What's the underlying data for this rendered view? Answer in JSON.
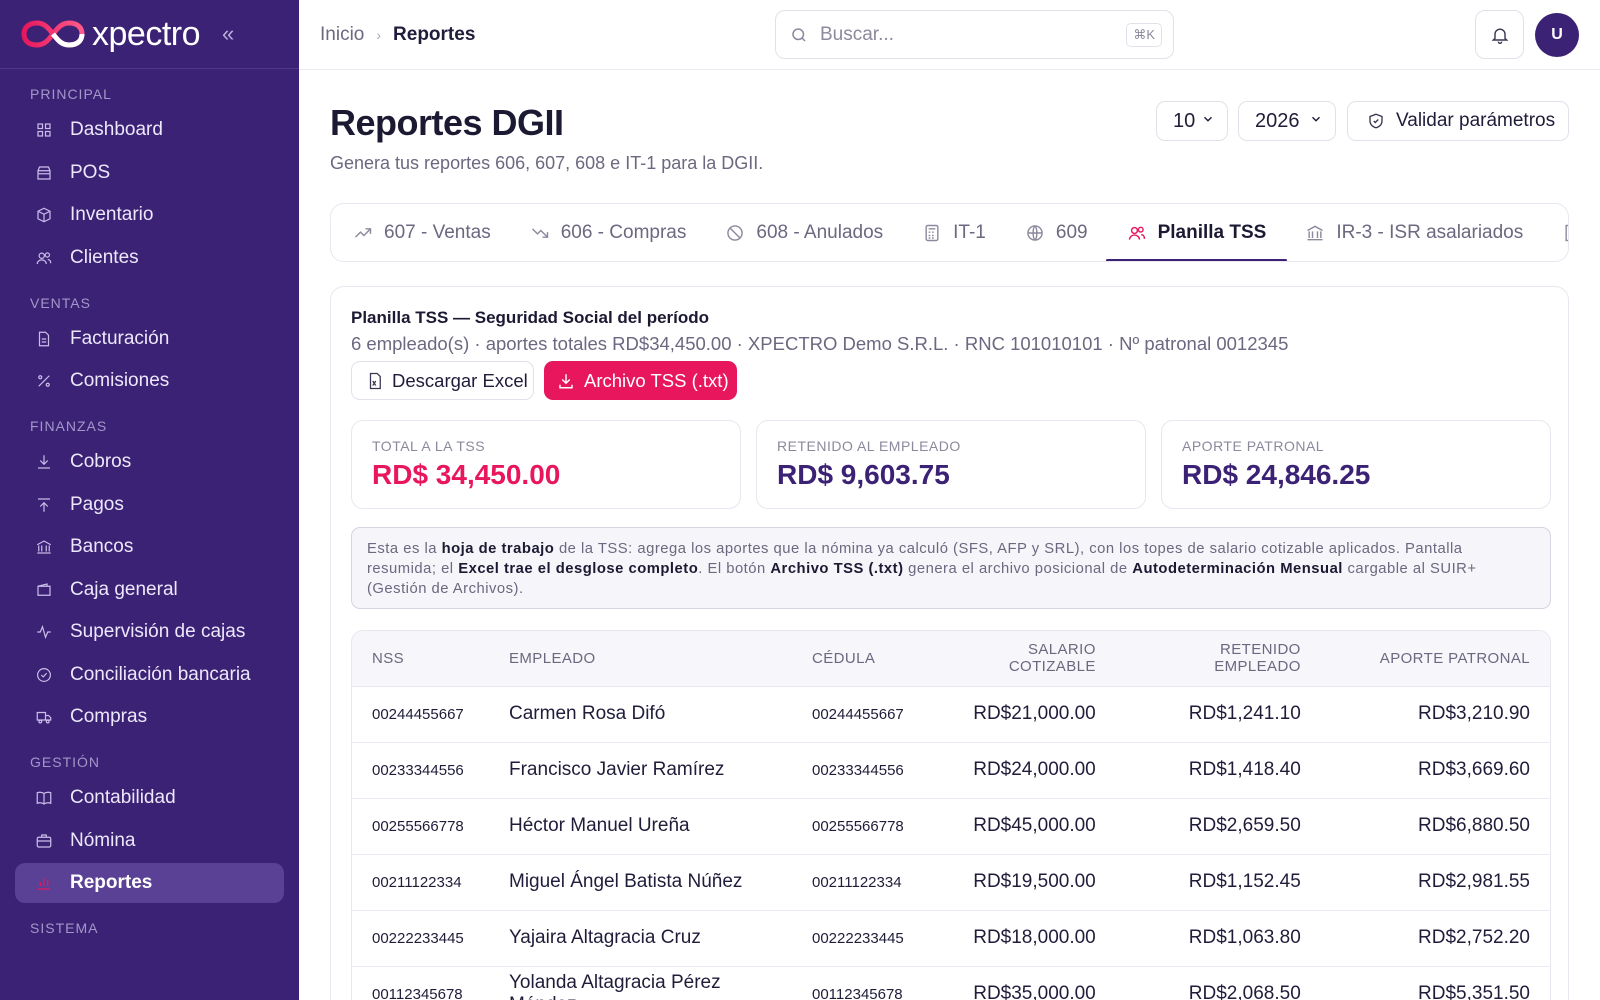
{
  "brand": {
    "name": "xpectro"
  },
  "sidebar": {
    "sections": [
      {
        "title": "PRINCIPAL",
        "items": [
          {
            "label": "Dashboard",
            "icon": "grid-icon"
          },
          {
            "label": "POS",
            "icon": "store-icon"
          },
          {
            "label": "Inventario",
            "icon": "box-icon"
          },
          {
            "label": "Clientes",
            "icon": "users-icon"
          }
        ]
      },
      {
        "title": "VENTAS",
        "items": [
          {
            "label": "Facturación",
            "icon": "file-icon"
          },
          {
            "label": "Comisiones",
            "icon": "percent-icon"
          }
        ]
      },
      {
        "title": "FINANZAS",
        "items": [
          {
            "label": "Cobros",
            "icon": "download-icon"
          },
          {
            "label": "Pagos",
            "icon": "upload-icon"
          },
          {
            "label": "Bancos",
            "icon": "bank-icon"
          },
          {
            "label": "Caja general",
            "icon": "wallet-icon"
          },
          {
            "label": "Supervisión de cajas",
            "icon": "activity-icon"
          },
          {
            "label": "Conciliación bancaria",
            "icon": "check-circle-icon"
          },
          {
            "label": "Compras",
            "icon": "truck-icon"
          }
        ]
      },
      {
        "title": "GESTIÓN",
        "items": [
          {
            "label": "Contabilidad",
            "icon": "book-icon"
          },
          {
            "label": "Nómina",
            "icon": "briefcase-icon"
          },
          {
            "label": "Reportes",
            "icon": "chart-icon",
            "active": true
          }
        ]
      },
      {
        "title": "SISTEMA",
        "items": []
      }
    ]
  },
  "topbar": {
    "breadcrumb": {
      "home": "Inicio",
      "current": "Reportes"
    },
    "search": {
      "placeholder": "Buscar...",
      "shortcut": "⌘K"
    },
    "user_initial": "U"
  },
  "page": {
    "title": "Reportes DGII",
    "subtitle": "Genera tus reportes 606, 607, 608 e IT-1 para la DGII.",
    "month": "10",
    "year": "2026",
    "validate_label": "Validar parámetros"
  },
  "tabs": [
    {
      "label": "607 - Ventas",
      "icon": "trending-up-icon"
    },
    {
      "label": "606 - Compras",
      "icon": "trending-down-icon"
    },
    {
      "label": "608 - Anulados",
      "icon": "ban-icon"
    },
    {
      "label": "IT-1",
      "icon": "calculator-icon"
    },
    {
      "label": "609",
      "icon": "globe-icon"
    },
    {
      "label": "Planilla TSS",
      "icon": "users-icon",
      "active": true
    },
    {
      "label": "IR-3 - ISR asalariados",
      "icon": "bank-icon"
    },
    {
      "label": "",
      "icon": "building-icon"
    }
  ],
  "planilla": {
    "title": "Planilla TSS — Seguridad Social del período",
    "meta": "6 empleado(s) · aportes totales RD$34,450.00 · XPECTRO Demo S.R.L. · RNC 101010101 · Nº patronal 0012345",
    "excel_label": "Descargar Excel",
    "tss_label": "Archivo TSS (.txt)",
    "stats": [
      {
        "label": "TOTAL A LA TSS",
        "value": "RD$ 34,450.00",
        "color": "#e8175d"
      },
      {
        "label": "RETENIDO AL EMPLEADO",
        "value": "RD$ 9,603.75",
        "color": "#3b2275"
      },
      {
        "label": "APORTE PATRONAL",
        "value": "RD$ 24,846.25",
        "color": "#3b2275"
      }
    ],
    "note": {
      "p1": "Esta es la ",
      "b1": "hoja de trabajo",
      "p2": " de la TSS: agrega los aportes que la nómina ya calculó (SFS, AFP y SRL), con los topes de salario cotizable aplicados. Pantalla resumida; el ",
      "b2": "Excel trae el desglose completo",
      "p3": ". El botón ",
      "b3": "Archivo TSS (.txt)",
      "p4": " genera el archivo posicional de ",
      "b4": "Autodeterminación Mensual",
      "p5": " cargable al SUIR+ (Gestión de Archivos)."
    },
    "table": {
      "headers": [
        "NSS",
        "EMPLEADO",
        "CÉDULA",
        "SALARIO COTIZABLE",
        "RETENIDO EMPLEADO",
        "APORTE PATRONAL"
      ],
      "rows": [
        [
          "00244455667",
          "Carmen Rosa Difó",
          "00244455667",
          "RD$21,000.00",
          "RD$1,241.10",
          "RD$3,210.90"
        ],
        [
          "00233344556",
          "Francisco Javier Ramírez",
          "00233344556",
          "RD$24,000.00",
          "RD$1,418.40",
          "RD$3,669.60"
        ],
        [
          "00255566778",
          "Héctor Manuel Ureña",
          "00255566778",
          "RD$45,000.00",
          "RD$2,659.50",
          "RD$6,880.50"
        ],
        [
          "00211122334",
          "Miguel Ángel Batista Núñez",
          "00211122334",
          "RD$19,500.00",
          "RD$1,152.45",
          "RD$2,981.55"
        ],
        [
          "00222233445",
          "Yajaira Altagracia Cruz",
          "00222233445",
          "RD$18,000.00",
          "RD$1,063.80",
          "RD$2,752.20"
        ],
        [
          "00112345678",
          "Yolanda Altagracia Pérez Méndez",
          "00112345678",
          "RD$35,000.00",
          "RD$2,068.50",
          "RD$5,351.50"
        ]
      ]
    }
  },
  "colors": {
    "sidebar": "#3b2275",
    "accent": "#e8175d"
  }
}
